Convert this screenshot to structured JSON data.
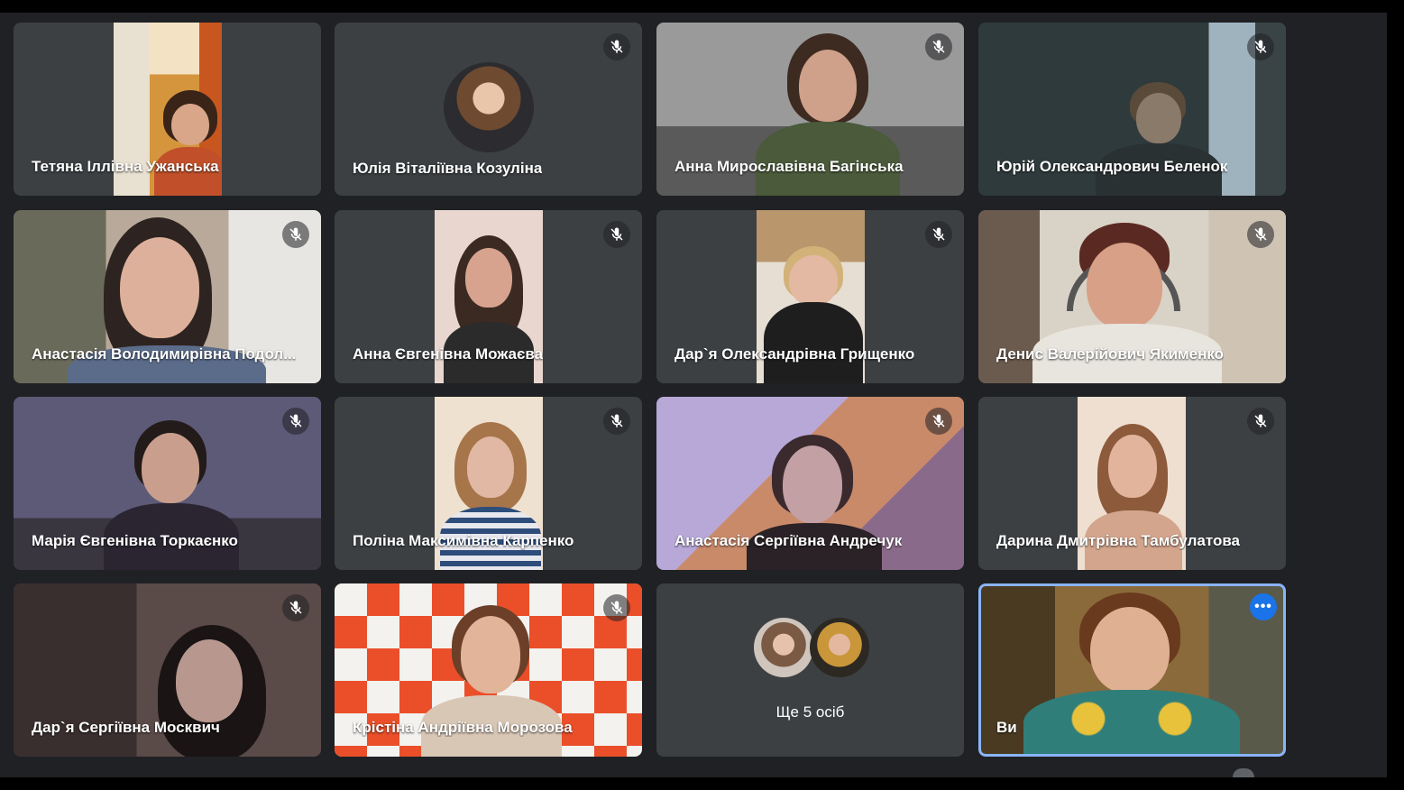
{
  "meeting": {
    "participants": [
      {
        "name": "Тетяна Іллівна Ужанська",
        "muted": false
      },
      {
        "name": "Юлія Віталіївна Козуліна",
        "muted": true
      },
      {
        "name": "Анна Мирославівна Багінська",
        "muted": true
      },
      {
        "name": "Юрій Олександрович Беленок",
        "muted": true
      },
      {
        "name": "Анастасія Володимирівна Подол...",
        "muted": true
      },
      {
        "name": "Анна Євгенівна Можаєва",
        "muted": true
      },
      {
        "name": "Дар`я Олександрівна Грищенко",
        "muted": true
      },
      {
        "name": "Денис Валерійович Якименко",
        "muted": true
      },
      {
        "name": "Марія Євгенівна Торкаєнко",
        "muted": true
      },
      {
        "name": "Поліна Максимівна Карпенко",
        "muted": true
      },
      {
        "name": "Анастасія Сергіївна Андречук",
        "muted": true
      },
      {
        "name": "Дарина Дмитрівна Тамбулатова",
        "muted": true
      },
      {
        "name": "Дар`я Сергіївна Москвич",
        "muted": true
      },
      {
        "name": "Крістіна Андріївна Морозова",
        "muted": true
      }
    ],
    "others_label": "Ще 5 осіб",
    "self": {
      "name": "Ви",
      "menu_icon": "more-horizontal-icon"
    },
    "mute_icon": "mic-off-icon",
    "colors": {
      "tile": "#3c4043",
      "stage": "#202124",
      "accent": "#1a73e8",
      "self_border": "#8ab4f8"
    }
  }
}
